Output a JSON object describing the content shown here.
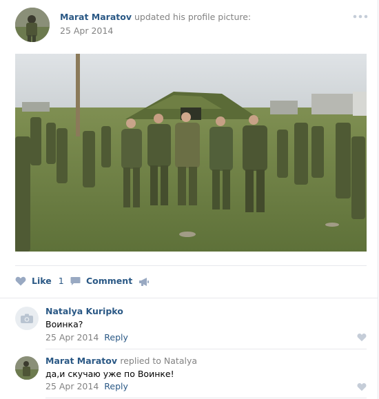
{
  "post": {
    "author_name": "Marat Maratov",
    "action_text": "updated his profile picture:",
    "date": "25 Apr 2014",
    "more_icon": "more-dots-icon"
  },
  "actions": {
    "like_label": "Like",
    "like_count": "1",
    "comment_label": "Comment",
    "share_icon": "megaphone-icon"
  },
  "comments": [
    {
      "author": "Natalya Kuripko",
      "text": "Воинка?",
      "date": "25 Apr 2014",
      "reply_label": "Reply"
    },
    {
      "author": "Marat Maratov",
      "reply_to": "replied to Natalya",
      "text": "да,и скучаю уже по Воинке!",
      "date": "25 Apr 2014",
      "reply_label": "Reply"
    }
  ],
  "colors": {
    "link": "#2a5885",
    "muted": "#828282",
    "icon": "#99a9c2",
    "divider": "#e7e8ec"
  }
}
